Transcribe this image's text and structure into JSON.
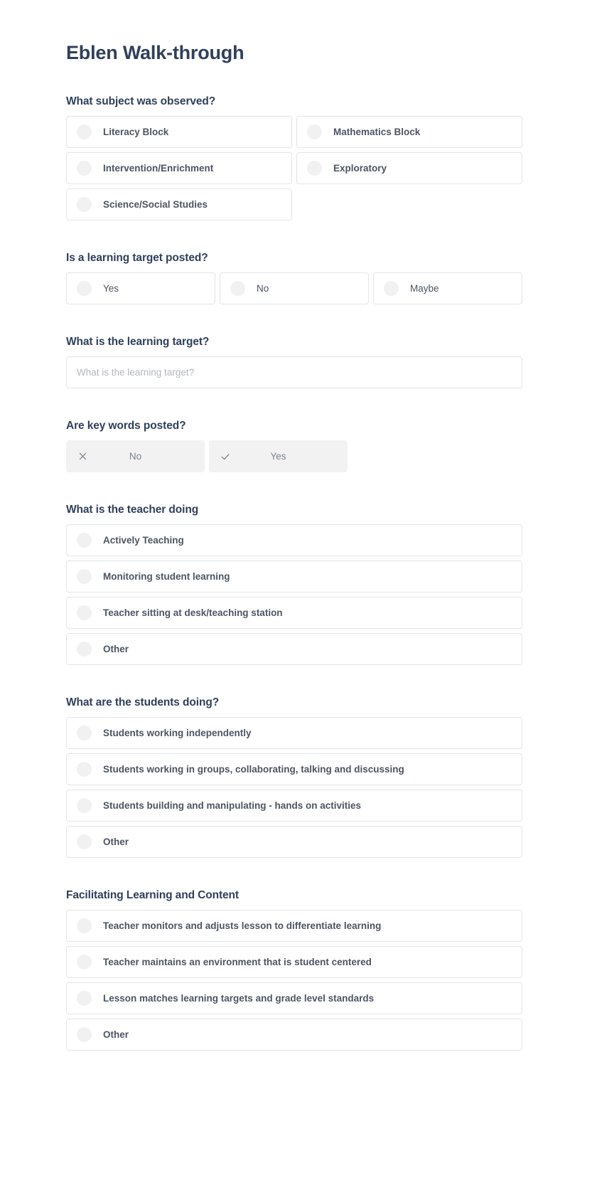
{
  "form": {
    "title": "Eblen Walk-through"
  },
  "colors": {
    "heading": "#30405a",
    "option_text": "#4d5562",
    "option_border": "#e3e5e7",
    "radio_fill": "#f1f1f2",
    "toggle_bg": "#f2f2f3",
    "toggle_text": "#7b828c",
    "placeholder": "#b3b7bd",
    "page_bg": "#ffffff"
  },
  "questions": [
    {
      "id": "subject-observed",
      "label": "What subject was observed?",
      "type": "radio-grid",
      "columns": 2,
      "options": [
        {
          "label": "Literacy Block"
        },
        {
          "label": "Mathematics Block"
        },
        {
          "label": "Intervention/Enrichment"
        },
        {
          "label": "Exploratory"
        },
        {
          "label": "Science/Social Studies"
        }
      ]
    },
    {
      "id": "learning-target-posted",
      "label": "Is a learning target posted?",
      "type": "radio-grid",
      "columns": 3,
      "weight": "light",
      "options": [
        {
          "label": "Yes"
        },
        {
          "label": "No"
        },
        {
          "label": "Maybe"
        }
      ]
    },
    {
      "id": "learning-target-text",
      "label": "What is the learning target?",
      "type": "text",
      "value": "",
      "placeholder": "What is the learning target?"
    },
    {
      "id": "key-words-posted",
      "label": "Are key words posted?",
      "type": "toggle",
      "options": [
        {
          "label": "No",
          "icon": "close-icon"
        },
        {
          "label": "Yes",
          "icon": "check-icon"
        }
      ]
    },
    {
      "id": "teacher-doing",
      "label": "What is the teacher doing",
      "type": "radio-grid",
      "columns": 1,
      "options": [
        {
          "label": "Actively Teaching"
        },
        {
          "label": "Monitoring student learning"
        },
        {
          "label": "Teacher sitting at desk/teaching station"
        },
        {
          "label": "Other"
        }
      ]
    },
    {
      "id": "students-doing",
      "label": "What are the students doing?",
      "type": "radio-grid",
      "columns": 1,
      "options": [
        {
          "label": "Students working independently"
        },
        {
          "label": "Students working in groups, collaborating, talking and discussing"
        },
        {
          "label": "Students building and manipulating - hands on activities"
        },
        {
          "label": "Other"
        }
      ]
    },
    {
      "id": "facilitating-learning",
      "label": "Facilitating Learning and Content",
      "type": "radio-grid",
      "columns": 1,
      "options": [
        {
          "label": "Teacher monitors and adjusts lesson to differentiate learning"
        },
        {
          "label": "Teacher maintains an environment that is student centered"
        },
        {
          "label": "Lesson matches learning targets and grade level standards"
        },
        {
          "label": "Other"
        }
      ]
    }
  ]
}
